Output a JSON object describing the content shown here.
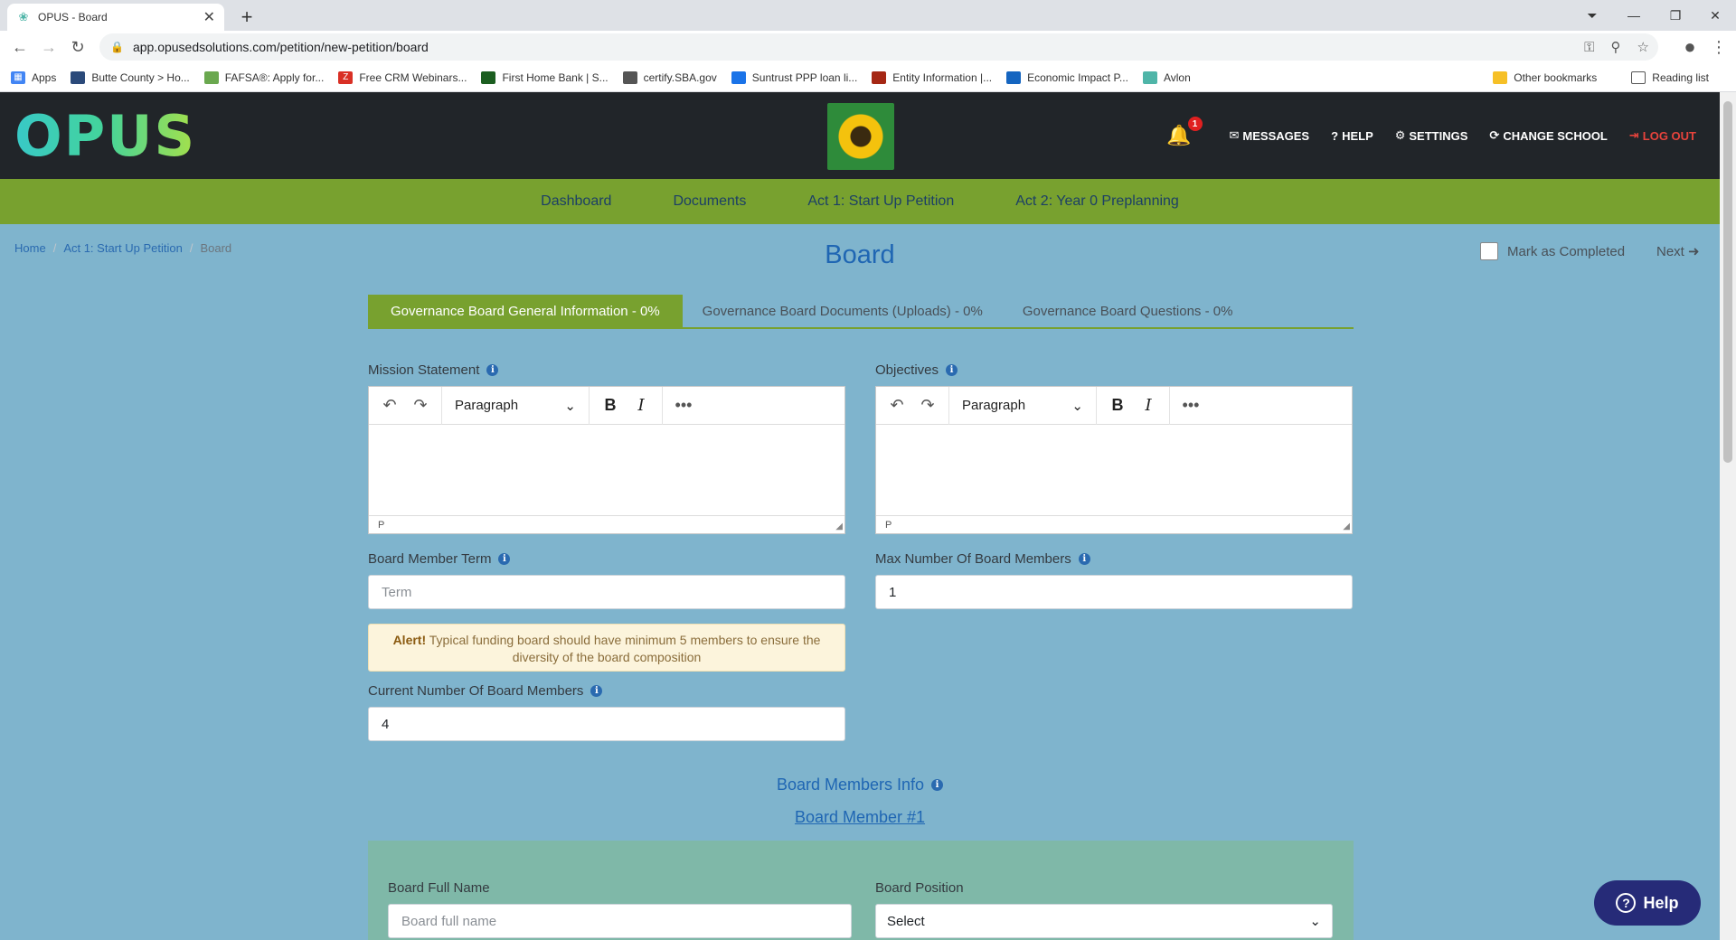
{
  "browser": {
    "tab_title": "OPUS - Board",
    "url": "app.opusedsolutions.com/petition/new-petition/board",
    "bookmarks": [
      {
        "label": "Apps",
        "color": "#4285f4"
      },
      {
        "label": "Butte County > Ho...",
        "color": "#2b4a7a"
      },
      {
        "label": "FAFSA®: Apply for...",
        "color": "#6aa84f"
      },
      {
        "label": "Free CRM Webinars...",
        "color": "#d93025"
      },
      {
        "label": "First Home Bank | S...",
        "color": "#1b5e20"
      },
      {
        "label": "certify.SBA.gov",
        "color": "#555555"
      },
      {
        "label": "Suntrust PPP loan li...",
        "color": "#1a73e8"
      },
      {
        "label": "Entity Information |...",
        "color": "#a52714"
      },
      {
        "label": "Economic Impact P...",
        "color": "#1565c0"
      },
      {
        "label": "Avlon",
        "color": "#4fb5a8"
      }
    ],
    "other_bookmarks": "Other bookmarks",
    "reading_list": "Reading list"
  },
  "header": {
    "logo": "OPUS",
    "notification_count": "1",
    "nav": {
      "messages": "MESSAGES",
      "help": "HELP",
      "settings": "SETTINGS",
      "change_school": "CHANGE SCHOOL",
      "logout": "LOG OUT"
    }
  },
  "main_nav": [
    "Dashboard",
    "Documents",
    "Act 1: Start Up Petition",
    "Act 2: Year 0 Preplanning"
  ],
  "breadcrumb": {
    "home": "Home",
    "act": "Act 1: Start Up Petition",
    "current": "Board"
  },
  "page": {
    "title": "Board",
    "mark_completed": "Mark as Completed",
    "next": "Next"
  },
  "tabs": [
    "Governance Board General Information - 0%",
    "Governance Board Documents (Uploads) - 0%",
    "Governance Board Questions - 0%"
  ],
  "form": {
    "mission_label": "Mission Statement",
    "objectives_label": "Objectives",
    "editor_block": "Paragraph",
    "editor_status": "P",
    "term_label": "Board Member Term",
    "term_placeholder": "Term",
    "max_label": "Max Number Of Board Members",
    "max_value": "1",
    "alert_strong": "Alert!",
    "alert_text": " Typical funding board should have minimum 5 members to ensure the diversity of the board composition",
    "current_label": "Current Number Of Board Members",
    "current_value": "4"
  },
  "members": {
    "section_title": "Board Members Info",
    "member_link": "Board Member #1",
    "full_name_label": "Board Full Name",
    "full_name_placeholder": "Board full name",
    "position_label": "Board Position",
    "position_selected": "Select"
  },
  "help_button": "Help"
}
